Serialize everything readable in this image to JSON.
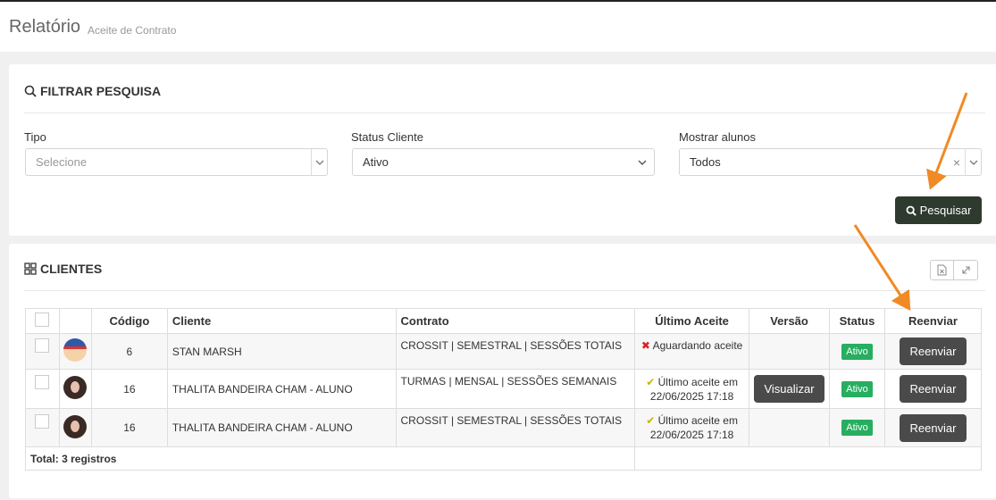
{
  "header": {
    "title": "Relatório",
    "subtitle": "Aceite de Contrato"
  },
  "filter": {
    "title": "FILTRAR PESQUISA",
    "icon": "search-icon",
    "tipo": {
      "label": "Tipo",
      "placeholder": "Selecione"
    },
    "status_cliente": {
      "label": "Status Cliente",
      "value": "Ativo"
    },
    "mostrar_alunos": {
      "label": "Mostrar alunos",
      "value": "Todos",
      "clear": "×"
    },
    "search_button": "Pesquisar"
  },
  "clients": {
    "title": "CLIENTES",
    "icon": "grid-icon",
    "columns": [
      "Código",
      "Cliente",
      "Contrato",
      "Último Aceite",
      "Versão",
      "Status",
      "Reenviar"
    ],
    "rows": [
      {
        "codigo": "6",
        "cliente": "STAN MARSH",
        "contrato": "CROSSIT | SEMESTRAL | SESSÕES TOTAIS",
        "aceite": "Aguardando aceite",
        "aceite_date": "",
        "versao": "",
        "status": "Ativo",
        "reenviar": "Reenviar"
      },
      {
        "codigo": "16",
        "cliente": "THALITA BANDEIRA CHAM - ALUNO",
        "contrato": "TURMAS | MENSAL | SESSÕES SEMANAIS",
        "aceite": "Último aceite em",
        "aceite_date": "22/06/2025 17:18",
        "versao": "Visualizar",
        "status": "Ativo",
        "reenviar": "Reenviar"
      },
      {
        "codigo": "16",
        "cliente": "THALITA BANDEIRA CHAM - ALUNO",
        "contrato": "CROSSIT | SEMESTRAL | SESSÕES TOTAIS",
        "aceite": "Último aceite em",
        "aceite_date": "22/06/2025 17:18",
        "versao": "",
        "status": "Ativo",
        "reenviar": "Reenviar"
      }
    ],
    "total": "Total: 3 registros"
  },
  "colors": {
    "status_active": "#27ae60",
    "search_button": "#2f3a2f",
    "annotation_arrow": "#f08a24"
  }
}
